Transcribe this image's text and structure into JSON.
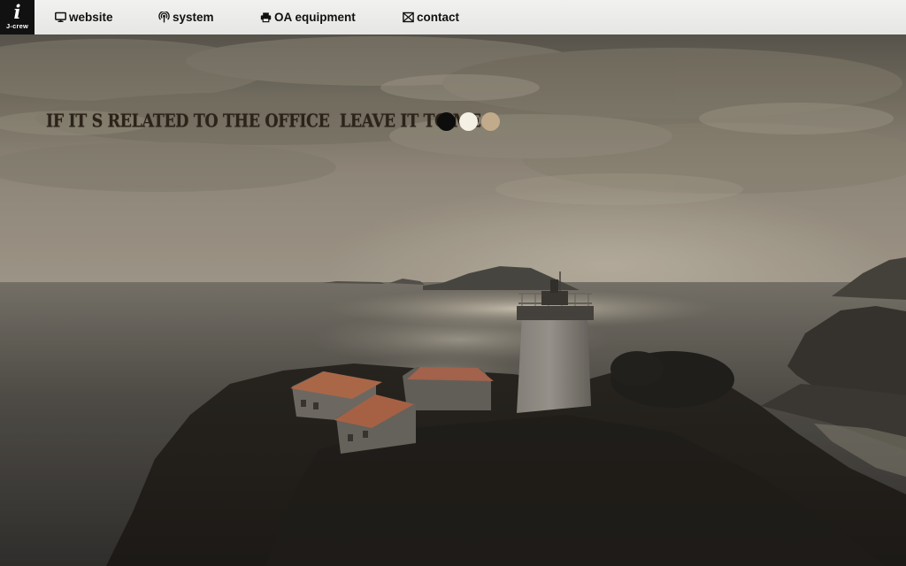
{
  "brand": {
    "logo_glyph": "i",
    "name": "J-crew"
  },
  "nav": {
    "items": [
      {
        "label": "website",
        "icon": "monitor-icon"
      },
      {
        "label": "system",
        "icon": "broadcast-icon"
      },
      {
        "label": "OA equipment",
        "icon": "printer-icon"
      },
      {
        "label": "contact",
        "icon": "envelope-icon"
      }
    ]
  },
  "hero": {
    "tagline": "IF IT S RELATED TO THE OFFICE  LEAVE IT TO ME",
    "color_dots": [
      {
        "color": "#0d0d0d"
      },
      {
        "color": "#f4f0e4"
      },
      {
        "color": "#c2ab8a"
      }
    ]
  }
}
